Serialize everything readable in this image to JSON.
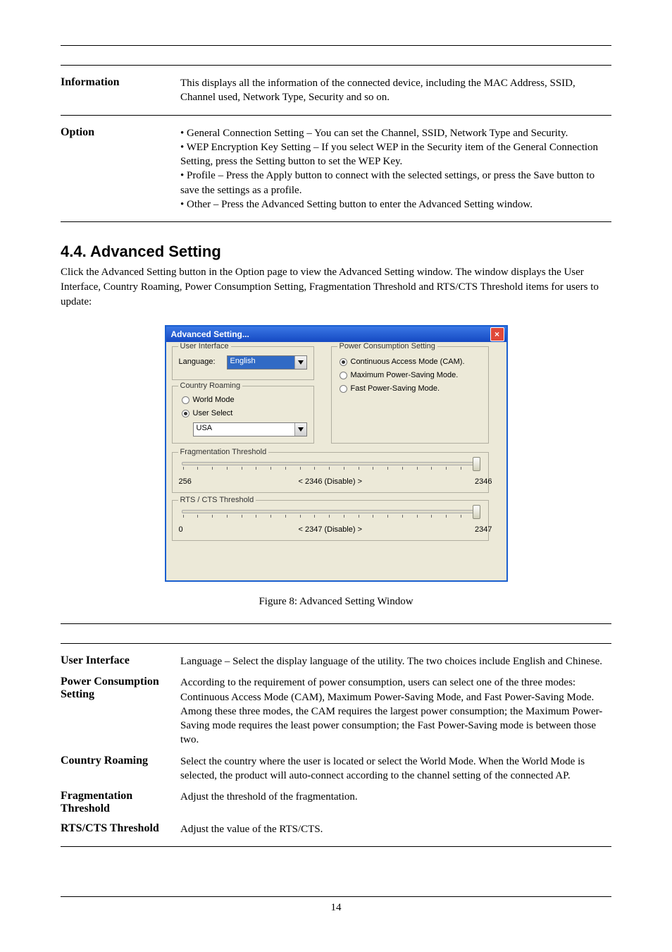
{
  "table1": {
    "row1_label": "Information",
    "row1_desc": "This displays all the information of the connected device, including the MAC Address, SSID, Channel used, Network Type, Security and so on.",
    "row2_label": "Option",
    "row2_desc": "• General Connection Setting – You can set the Channel, SSID, Network Type and Security.\n• WEP Encryption Key Setting – If you select WEP in the Security item of the General Connection Setting, press the Setting button to set the WEP Key.\n• Profile – Press the Apply button to connect with the selected settings, or press the Save button to save the settings as a profile.\n• Other – Press the Advanced Setting button to enter the Advanced Setting window."
  },
  "section": {
    "title": "4.4. Advanced Setting",
    "intro": "Click the Advanced Setting button in the Option page to view the Advanced Setting window. The window displays the User Interface, Country Roaming, Power Consumption Setting, Fragmentation Threshold and RTS/CTS Threshold items for users to update:"
  },
  "dialog": {
    "title": "Advanced Setting...",
    "ui_legend": "User Interface",
    "lang_label": "Language:",
    "lang_value": "English",
    "roaming_legend": "Country Roaming",
    "roaming_world": "World Mode",
    "roaming_user": "User Select",
    "roaming_country": "USA",
    "pcs_legend": "Power Consumption Setting",
    "pcs_cam": "Continuous Access Mode (CAM).",
    "pcs_max": "Maximum Power-Saving Mode.",
    "pcs_fast": "Fast Power-Saving Mode.",
    "frag_legend": "Fragmentation Threshold",
    "frag_min": "256",
    "frag_value": "< 2346 (Disable) >",
    "frag_max": "2346",
    "rts_legend": "RTS / CTS Threshold",
    "rts_min": "0",
    "rts_value": "< 2347 (Disable) >",
    "rts_max": "2347"
  },
  "caption": "Figure 8: Advanced Setting Window",
  "table2": {
    "row1_label": "User Interface",
    "row1_desc": "Language – Select the display language of the utility. The two choices include English and Chinese.",
    "row2_label": "Power Consumption Setting",
    "row2_desc": "According to the requirement of power consumption, users can select one of the three modes: Continuous Access Mode (CAM), Maximum Power-Saving Mode, and Fast Power-Saving Mode. Among these three modes, the CAM requires the largest power consumption; the Maximum Power-Saving mode requires the least power consumption; the Fast Power-Saving mode is between those two.",
    "row3_label": "Country Roaming",
    "row3_desc": "Select the country where the user is located or select the World Mode. When the World Mode is selected, the product will auto-connect according to the channel setting of the connected AP.",
    "row4_label": "Fragmentation Threshold",
    "row4_desc": "Adjust the threshold of the fragmentation.",
    "row5_label": "RTS/CTS Threshold",
    "row5_desc": "Adjust the value of the RTS/CTS."
  },
  "pagenum": "14"
}
